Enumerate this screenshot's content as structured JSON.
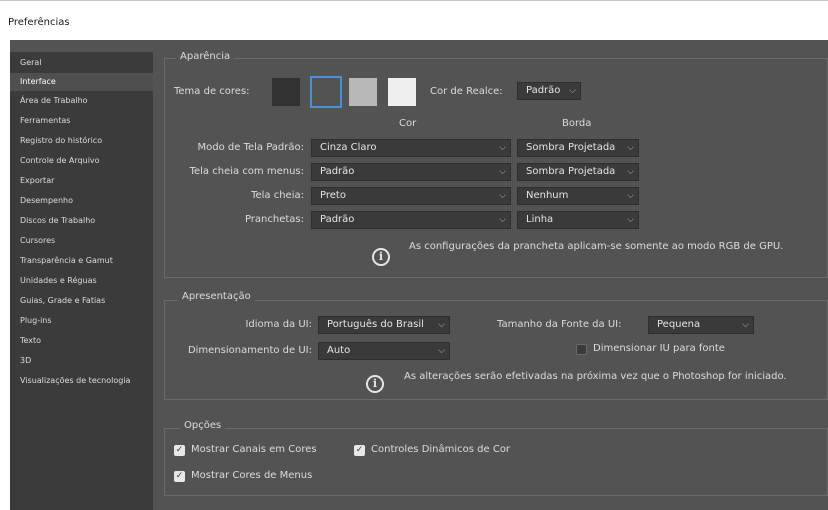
{
  "window": {
    "title": "Preferências"
  },
  "sidebar": {
    "items": [
      {
        "label": "Geral"
      },
      {
        "label": "Interface"
      },
      {
        "label": "Área de Trabalho"
      },
      {
        "label": "Ferramentas"
      },
      {
        "label": "Registro do histórico"
      },
      {
        "label": "Controle de Arquivo"
      },
      {
        "label": "Exportar"
      },
      {
        "label": "Desempenho"
      },
      {
        "label": "Discos de Trabalho"
      },
      {
        "label": "Cursores"
      },
      {
        "label": "Transparência e Gamut"
      },
      {
        "label": "Unidades e Réguas"
      },
      {
        "label": "Guias, Grade e Fatias"
      },
      {
        "label": "Plug-ins"
      },
      {
        "label": "Texto"
      },
      {
        "label": "3D"
      },
      {
        "label": "Visualizações de tecnologia"
      }
    ],
    "selected": "Interface"
  },
  "aparencia": {
    "title": "Aparência",
    "tema_label": "Tema de cores:",
    "swatches": [
      "#323232",
      "#535353",
      "#b8b8b8",
      "#f0f0f0"
    ],
    "selected_swatch": 1,
    "realce_label": "Cor de Realce:",
    "realce_value": "Padrão",
    "col_cor": "Cor",
    "col_borda": "Borda",
    "rows": [
      {
        "label": "Modo de Tela Padrão:",
        "cor": "Cinza Claro",
        "borda": "Sombra Projetada"
      },
      {
        "label": "Tela cheia com menus:",
        "cor": "Padrão",
        "borda": "Sombra Projetada"
      },
      {
        "label": "Tela cheia:",
        "cor": "Preto",
        "borda": "Nenhum"
      },
      {
        "label": "Pranchetas:",
        "cor": "Padrão",
        "borda": "Linha"
      }
    ],
    "info": "As configurações da prancheta aplicam-se somente ao modo RGB de GPU."
  },
  "apresentacao": {
    "title": "Apresentação",
    "idioma_label": "Idioma da UI:",
    "idioma_value": "Português do Brasil",
    "fonte_label": "Tamanho da Fonte da UI:",
    "fonte_value": "Pequena",
    "dimens_label": "Dimensionamento de UI:",
    "dimens_value": "Auto",
    "dim_fonte_label": "Dimensionar IU para fonte",
    "dim_fonte_checked": false,
    "info": "As alterações serão efetivadas na próxima vez que o Photoshop for iniciado."
  },
  "opcoes": {
    "title": "Opções",
    "items": [
      {
        "label": "Mostrar Canais em Cores",
        "checked": true
      },
      {
        "label": "Controles Dinâmicos de Cor",
        "checked": true
      },
      {
        "label": "Mostrar Cores de Menus",
        "checked": true
      }
    ]
  },
  "icons": {
    "info": "info-icon",
    "chevron": "chevron-down-icon",
    "check": "checkmark-icon"
  },
  "colors": {
    "panel": "#535353",
    "sidebar": "#3b3b3b",
    "field": "#3a3a3a",
    "text": "#dcdcdc"
  }
}
